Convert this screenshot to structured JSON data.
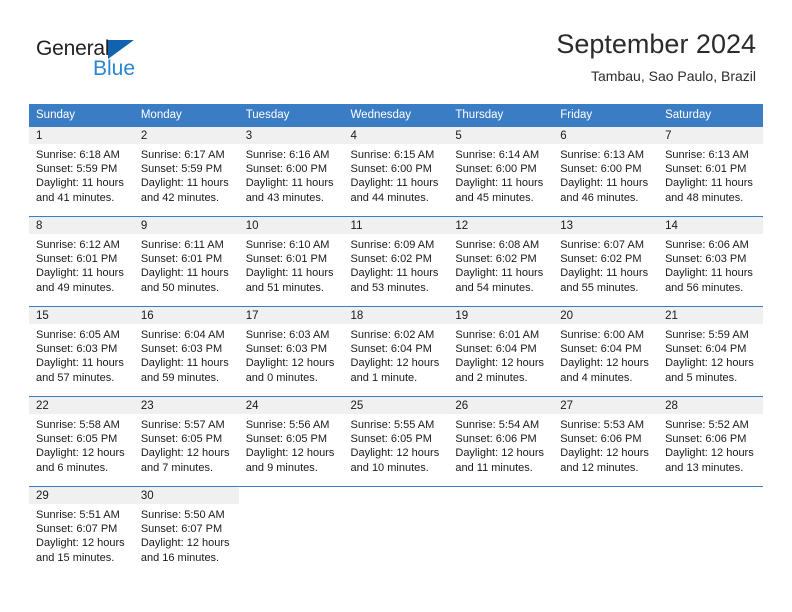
{
  "brand": {
    "word_general": "General",
    "word_blue": "Blue",
    "triangle_color": "#1263ad",
    "blue_color": "#2a86d0"
  },
  "header": {
    "title": "September 2024",
    "subtitle": "Tambau, Sao Paulo, Brazil"
  },
  "theme": {
    "header_bar_color": "#3b7dc4",
    "daynum_band_color": "#f0f0f0",
    "text_color": "#1a1a1a"
  },
  "weekday_headers": [
    "Sunday",
    "Monday",
    "Tuesday",
    "Wednesday",
    "Thursday",
    "Friday",
    "Saturday"
  ],
  "weeks": [
    [
      {
        "day": "1",
        "sunrise": "Sunrise: 6:18 AM",
        "sunset": "Sunset: 5:59 PM",
        "daylight_1": "Daylight: 11 hours",
        "daylight_2": "and 41 minutes."
      },
      {
        "day": "2",
        "sunrise": "Sunrise: 6:17 AM",
        "sunset": "Sunset: 5:59 PM",
        "daylight_1": "Daylight: 11 hours",
        "daylight_2": "and 42 minutes."
      },
      {
        "day": "3",
        "sunrise": "Sunrise: 6:16 AM",
        "sunset": "Sunset: 6:00 PM",
        "daylight_1": "Daylight: 11 hours",
        "daylight_2": "and 43 minutes."
      },
      {
        "day": "4",
        "sunrise": "Sunrise: 6:15 AM",
        "sunset": "Sunset: 6:00 PM",
        "daylight_1": "Daylight: 11 hours",
        "daylight_2": "and 44 minutes."
      },
      {
        "day": "5",
        "sunrise": "Sunrise: 6:14 AM",
        "sunset": "Sunset: 6:00 PM",
        "daylight_1": "Daylight: 11 hours",
        "daylight_2": "and 45 minutes."
      },
      {
        "day": "6",
        "sunrise": "Sunrise: 6:13 AM",
        "sunset": "Sunset: 6:00 PM",
        "daylight_1": "Daylight: 11 hours",
        "daylight_2": "and 46 minutes."
      },
      {
        "day": "7",
        "sunrise": "Sunrise: 6:13 AM",
        "sunset": "Sunset: 6:01 PM",
        "daylight_1": "Daylight: 11 hours",
        "daylight_2": "and 48 minutes."
      }
    ],
    [
      {
        "day": "8",
        "sunrise": "Sunrise: 6:12 AM",
        "sunset": "Sunset: 6:01 PM",
        "daylight_1": "Daylight: 11 hours",
        "daylight_2": "and 49 minutes."
      },
      {
        "day": "9",
        "sunrise": "Sunrise: 6:11 AM",
        "sunset": "Sunset: 6:01 PM",
        "daylight_1": "Daylight: 11 hours",
        "daylight_2": "and 50 minutes."
      },
      {
        "day": "10",
        "sunrise": "Sunrise: 6:10 AM",
        "sunset": "Sunset: 6:01 PM",
        "daylight_1": "Daylight: 11 hours",
        "daylight_2": "and 51 minutes."
      },
      {
        "day": "11",
        "sunrise": "Sunrise: 6:09 AM",
        "sunset": "Sunset: 6:02 PM",
        "daylight_1": "Daylight: 11 hours",
        "daylight_2": "and 53 minutes."
      },
      {
        "day": "12",
        "sunrise": "Sunrise: 6:08 AM",
        "sunset": "Sunset: 6:02 PM",
        "daylight_1": "Daylight: 11 hours",
        "daylight_2": "and 54 minutes."
      },
      {
        "day": "13",
        "sunrise": "Sunrise: 6:07 AM",
        "sunset": "Sunset: 6:02 PM",
        "daylight_1": "Daylight: 11 hours",
        "daylight_2": "and 55 minutes."
      },
      {
        "day": "14",
        "sunrise": "Sunrise: 6:06 AM",
        "sunset": "Sunset: 6:03 PM",
        "daylight_1": "Daylight: 11 hours",
        "daylight_2": "and 56 minutes."
      }
    ],
    [
      {
        "day": "15",
        "sunrise": "Sunrise: 6:05 AM",
        "sunset": "Sunset: 6:03 PM",
        "daylight_1": "Daylight: 11 hours",
        "daylight_2": "and 57 minutes."
      },
      {
        "day": "16",
        "sunrise": "Sunrise: 6:04 AM",
        "sunset": "Sunset: 6:03 PM",
        "daylight_1": "Daylight: 11 hours",
        "daylight_2": "and 59 minutes."
      },
      {
        "day": "17",
        "sunrise": "Sunrise: 6:03 AM",
        "sunset": "Sunset: 6:03 PM",
        "daylight_1": "Daylight: 12 hours",
        "daylight_2": "and 0 minutes."
      },
      {
        "day": "18",
        "sunrise": "Sunrise: 6:02 AM",
        "sunset": "Sunset: 6:04 PM",
        "daylight_1": "Daylight: 12 hours",
        "daylight_2": "and 1 minute."
      },
      {
        "day": "19",
        "sunrise": "Sunrise: 6:01 AM",
        "sunset": "Sunset: 6:04 PM",
        "daylight_1": "Daylight: 12 hours",
        "daylight_2": "and 2 minutes."
      },
      {
        "day": "20",
        "sunrise": "Sunrise: 6:00 AM",
        "sunset": "Sunset: 6:04 PM",
        "daylight_1": "Daylight: 12 hours",
        "daylight_2": "and 4 minutes."
      },
      {
        "day": "21",
        "sunrise": "Sunrise: 5:59 AM",
        "sunset": "Sunset: 6:04 PM",
        "daylight_1": "Daylight: 12 hours",
        "daylight_2": "and 5 minutes."
      }
    ],
    [
      {
        "day": "22",
        "sunrise": "Sunrise: 5:58 AM",
        "sunset": "Sunset: 6:05 PM",
        "daylight_1": "Daylight: 12 hours",
        "daylight_2": "and 6 minutes."
      },
      {
        "day": "23",
        "sunrise": "Sunrise: 5:57 AM",
        "sunset": "Sunset: 6:05 PM",
        "daylight_1": "Daylight: 12 hours",
        "daylight_2": "and 7 minutes."
      },
      {
        "day": "24",
        "sunrise": "Sunrise: 5:56 AM",
        "sunset": "Sunset: 6:05 PM",
        "daylight_1": "Daylight: 12 hours",
        "daylight_2": "and 9 minutes."
      },
      {
        "day": "25",
        "sunrise": "Sunrise: 5:55 AM",
        "sunset": "Sunset: 6:05 PM",
        "daylight_1": "Daylight: 12 hours",
        "daylight_2": "and 10 minutes."
      },
      {
        "day": "26",
        "sunrise": "Sunrise: 5:54 AM",
        "sunset": "Sunset: 6:06 PM",
        "daylight_1": "Daylight: 12 hours",
        "daylight_2": "and 11 minutes."
      },
      {
        "day": "27",
        "sunrise": "Sunrise: 5:53 AM",
        "sunset": "Sunset: 6:06 PM",
        "daylight_1": "Daylight: 12 hours",
        "daylight_2": "and 12 minutes."
      },
      {
        "day": "28",
        "sunrise": "Sunrise: 5:52 AM",
        "sunset": "Sunset: 6:06 PM",
        "daylight_1": "Daylight: 12 hours",
        "daylight_2": "and 13 minutes."
      }
    ],
    [
      {
        "day": "29",
        "sunrise": "Sunrise: 5:51 AM",
        "sunset": "Sunset: 6:07 PM",
        "daylight_1": "Daylight: 12 hours",
        "daylight_2": "and 15 minutes."
      },
      {
        "day": "30",
        "sunrise": "Sunrise: 5:50 AM",
        "sunset": "Sunset: 6:07 PM",
        "daylight_1": "Daylight: 12 hours",
        "daylight_2": "and 16 minutes."
      },
      {
        "day": "",
        "sunrise": "",
        "sunset": "",
        "daylight_1": "",
        "daylight_2": ""
      },
      {
        "day": "",
        "sunrise": "",
        "sunset": "",
        "daylight_1": "",
        "daylight_2": ""
      },
      {
        "day": "",
        "sunrise": "",
        "sunset": "",
        "daylight_1": "",
        "daylight_2": ""
      },
      {
        "day": "",
        "sunrise": "",
        "sunset": "",
        "daylight_1": "",
        "daylight_2": ""
      },
      {
        "day": "",
        "sunrise": "",
        "sunset": "",
        "daylight_1": "",
        "daylight_2": ""
      }
    ]
  ]
}
